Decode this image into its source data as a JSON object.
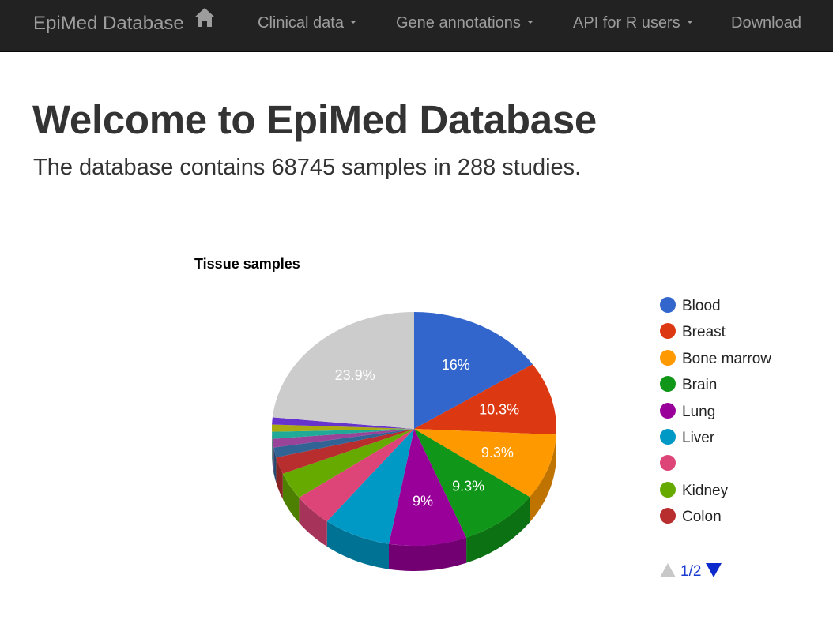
{
  "navbar": {
    "brand": "EpiMed Database",
    "home_icon": "home-icon",
    "items": [
      {
        "label": "Clinical data",
        "dropdown": true
      },
      {
        "label": "Gene annotations",
        "dropdown": true
      },
      {
        "label": "API for R users",
        "dropdown": true
      },
      {
        "label": "Download",
        "dropdown": false
      }
    ]
  },
  "page": {
    "title": "Welcome to EpiMed Database",
    "subtitle": "The database contains 68745 samples in 288 studies."
  },
  "chart_data": {
    "type": "pie",
    "title": "Tissue samples",
    "is3d": true,
    "slices": [
      {
        "label": "Blood",
        "value": 16,
        "color": "#3366cc",
        "shown_label": "16%"
      },
      {
        "label": "Breast",
        "value": 10.3,
        "color": "#dc3912",
        "shown_label": "10.3%"
      },
      {
        "label": "Bone marrow",
        "value": 9.3,
        "color": "#ff9900",
        "shown_label": "9.3%"
      },
      {
        "label": "Brain",
        "value": 9.3,
        "color": "#109618",
        "shown_label": "9.3%"
      },
      {
        "label": "Lung",
        "value": 9,
        "color": "#990099",
        "shown_label": "9%"
      },
      {
        "label": "Liver",
        "value": 7.8,
        "color": "#0099c6",
        "shown_label": ""
      },
      {
        "label": "",
        "value": 4.6,
        "color": "#dd4477",
        "shown_label": ""
      },
      {
        "label": "Kidney",
        "value": 3.8,
        "color": "#66aa00",
        "shown_label": ""
      },
      {
        "label": "Colon",
        "value": 2.4,
        "color": "#b82e2e",
        "shown_label": ""
      },
      {
        "label": "",
        "value": 1.4,
        "color": "#316395",
        "shown_label": ""
      },
      {
        "label": "",
        "value": 1.2,
        "color": "#994499",
        "shown_label": ""
      },
      {
        "label": "",
        "value": 1.0,
        "color": "#22aa99",
        "shown_label": ""
      },
      {
        "label": "",
        "value": 1.0,
        "color": "#aaaa11",
        "shown_label": ""
      },
      {
        "label": "",
        "value": 1.0,
        "color": "#6633cc",
        "shown_label": ""
      },
      {
        "label": "",
        "value": 23.9,
        "color": "#cccccc",
        "shown_label": "23.9%"
      }
    ],
    "legend": {
      "position": "right",
      "page": "1/2"
    }
  }
}
